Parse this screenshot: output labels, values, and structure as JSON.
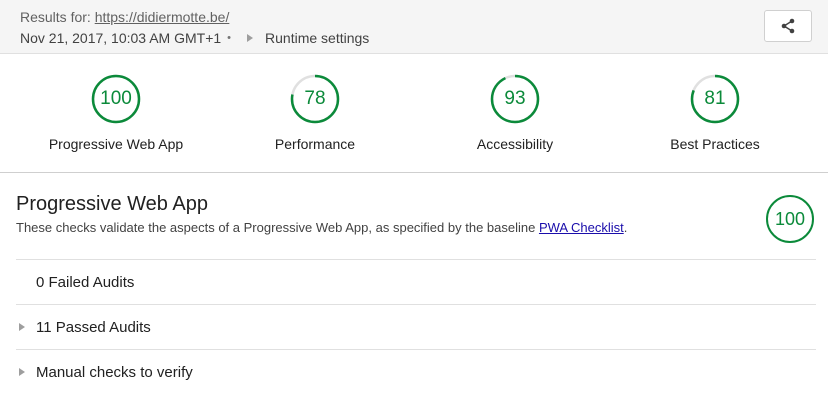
{
  "header": {
    "results_prefix": "Results for: ",
    "url": "https://didiermotte.be/",
    "timestamp": "Nov 21, 2017, 10:03 AM GMT+1",
    "separator": "•",
    "runtime_settings": "Runtime settings",
    "share_icon": "share-icon"
  },
  "gauges": [
    {
      "value": "100",
      "label": "Progressive Web App",
      "score": 100
    },
    {
      "value": "78",
      "label": "Performance",
      "score": 78
    },
    {
      "value": "93",
      "label": "Accessibility",
      "score": 93
    },
    {
      "value": "81",
      "label": "Best Practices",
      "score": 81
    }
  ],
  "category": {
    "title": "Progressive Web App",
    "description_prefix": "These checks validate the aspects of a Progressive Web App, as specified by the baseline ",
    "description_link": "PWA Checklist",
    "description_suffix": ".",
    "score": "100",
    "score_fraction": 1.0
  },
  "audit_groups": [
    {
      "label": "0 Failed Audits",
      "expandable": false
    },
    {
      "label": "11 Passed Audits",
      "expandable": true
    },
    {
      "label": "Manual checks to verify",
      "expandable": true
    }
  ],
  "colors": {
    "pass_green": "#0b8a3a",
    "track_gray": "#e0e0e0",
    "link_blue": "#1a0dab"
  }
}
